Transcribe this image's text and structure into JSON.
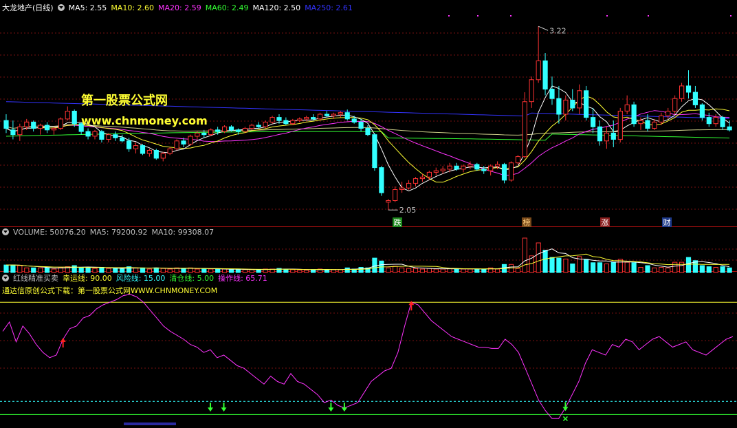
{
  "colors": {
    "ma5": "#ffffff",
    "ma10": "#ffff33",
    "ma20": "#ff33ff",
    "ma60": "#33ff33",
    "ma120": "#ffffff",
    "ma250": "#3333ff",
    "up": "#ff3333",
    "down": "#33ffff",
    "lucky": "#ffff33",
    "risk": "#33ffff",
    "clear": "#33ff33",
    "op": "#ff33ff"
  },
  "price_panel": {
    "stock_name": "大龙地产(日线)",
    "ma_labels": [
      {
        "text": "MA5: 2.55",
        "color": "#ffffff"
      },
      {
        "text": "MA10: 2.60",
        "color": "#ffff33"
      },
      {
        "text": "MA20: 2.59",
        "color": "#ff33ff"
      },
      {
        "text": "MA60: 2.49",
        "color": "#33ff33"
      },
      {
        "text": "MA120: 2.50",
        "color": "#ffffff"
      },
      {
        "text": "MA250: 2.61",
        "color": "#3333ff"
      }
    ],
    "high_label": "3.22",
    "low_label": "2.05",
    "markers": [
      {
        "text": "跌",
        "bg": "#1e8a1e",
        "fg": "#ffffff"
      },
      {
        "text": "榜",
        "bg": "#7a4a1a",
        "fg": "#ffd080"
      },
      {
        "text": "涨",
        "bg": "#8a1e1e",
        "fg": "#ffffff"
      },
      {
        "text": "财",
        "bg": "#1e3a8a",
        "fg": "#ffffff"
      }
    ]
  },
  "watermark": {
    "cn": "第一股票公式网",
    "url": "www.chnmoney.com"
  },
  "volume_panel": {
    "labels": [
      {
        "text": "VOLUME: 50076.20",
        "color": "#c0c0c0"
      },
      {
        "text": "MA5: 79200.92",
        "color": "#c0c0c0"
      },
      {
        "text": "MA10: 99308.07",
        "color": "#c0c0c0"
      }
    ]
  },
  "indicator_panel": {
    "labels": [
      {
        "text": "红线精准买卖",
        "color": "#c0c0c0"
      },
      {
        "text": "幸运线: 90.00",
        "color": "#ffff33"
      },
      {
        "text": "风险线: 15.00",
        "color": "#33ffff"
      },
      {
        "text": "清仓线: 5.00",
        "color": "#33ff33"
      },
      {
        "text": "操作线: 65.71",
        "color": "#ff33ff"
      }
    ],
    "note": "通达信原创公式下载：第一股票公式网WWW.CHNMONEY.COM"
  },
  "chart_data": {
    "type": "candlestick",
    "price_ylim": [
      1.95,
      3.3
    ],
    "indicator_ylim": [
      0,
      100
    ],
    "reference_lines": {
      "lucky": 90,
      "risk": 15,
      "clear": 5
    },
    "ohlc": [
      [
        2.62,
        2.66,
        2.54,
        2.57
      ],
      [
        2.56,
        2.62,
        2.5,
        2.53
      ],
      [
        2.53,
        2.6,
        2.49,
        2.58
      ],
      [
        2.58,
        2.63,
        2.56,
        2.61
      ],
      [
        2.61,
        2.62,
        2.55,
        2.57
      ],
      [
        2.57,
        2.6,
        2.53,
        2.59
      ],
      [
        2.59,
        2.61,
        2.54,
        2.56
      ],
      [
        2.56,
        2.58,
        2.53,
        2.57
      ],
      [
        2.57,
        2.64,
        2.56,
        2.63
      ],
      [
        2.63,
        2.71,
        2.62,
        2.68
      ],
      [
        2.68,
        2.69,
        2.58,
        2.6
      ],
      [
        2.6,
        2.61,
        2.53,
        2.55
      ],
      [
        2.55,
        2.57,
        2.5,
        2.52
      ],
      [
        2.52,
        2.56,
        2.5,
        2.55
      ],
      [
        2.55,
        2.56,
        2.48,
        2.5
      ],
      [
        2.5,
        2.54,
        2.48,
        2.53
      ],
      [
        2.53,
        2.55,
        2.49,
        2.51
      ],
      [
        2.51,
        2.53,
        2.48,
        2.49
      ],
      [
        2.49,
        2.51,
        2.42,
        2.44
      ],
      [
        2.44,
        2.48,
        2.41,
        2.46
      ],
      [
        2.46,
        2.47,
        2.4,
        2.41
      ],
      [
        2.41,
        2.44,
        2.39,
        2.43
      ],
      [
        2.43,
        2.44,
        2.37,
        2.38
      ],
      [
        2.38,
        2.42,
        2.36,
        2.41
      ],
      [
        2.41,
        2.45,
        2.4,
        2.44
      ],
      [
        2.44,
        2.5,
        2.43,
        2.49
      ],
      [
        2.49,
        2.51,
        2.45,
        2.47
      ],
      [
        2.47,
        2.53,
        2.46,
        2.52
      ],
      [
        2.52,
        2.55,
        2.5,
        2.54
      ],
      [
        2.54,
        2.56,
        2.51,
        2.53
      ],
      [
        2.53,
        2.57,
        2.52,
        2.56
      ],
      [
        2.56,
        2.58,
        2.53,
        2.55
      ],
      [
        2.55,
        2.59,
        2.54,
        2.58
      ],
      [
        2.58,
        2.59,
        2.55,
        2.56
      ],
      [
        2.56,
        2.57,
        2.53,
        2.55
      ],
      [
        2.55,
        2.58,
        2.54,
        2.57
      ],
      [
        2.57,
        2.6,
        2.56,
        2.59
      ],
      [
        2.59,
        2.61,
        2.57,
        2.58
      ],
      [
        2.58,
        2.62,
        2.57,
        2.61
      ],
      [
        2.61,
        2.65,
        2.6,
        2.64
      ],
      [
        2.64,
        2.66,
        2.6,
        2.62
      ],
      [
        2.62,
        2.64,
        2.59,
        2.6
      ],
      [
        2.6,
        2.63,
        2.59,
        2.62
      ],
      [
        2.62,
        2.64,
        2.61,
        2.63
      ],
      [
        2.63,
        2.65,
        2.62,
        2.64
      ],
      [
        2.64,
        2.66,
        2.62,
        2.63
      ],
      [
        2.63,
        2.67,
        2.62,
        2.66
      ],
      [
        2.66,
        2.68,
        2.64,
        2.65
      ],
      [
        2.65,
        2.67,
        2.63,
        2.66
      ],
      [
        2.66,
        2.68,
        2.64,
        2.67
      ],
      [
        2.67,
        2.69,
        2.62,
        2.63
      ],
      [
        2.63,
        2.65,
        2.6,
        2.61
      ],
      [
        2.61,
        2.63,
        2.55,
        2.57
      ],
      [
        2.57,
        2.59,
        2.52,
        2.53
      ],
      [
        2.53,
        2.54,
        2.3,
        2.32
      ],
      [
        2.32,
        2.33,
        2.14,
        2.16
      ],
      [
        2.1,
        2.12,
        2.05,
        2.11
      ],
      [
        2.11,
        2.2,
        2.1,
        2.18
      ],
      [
        2.18,
        2.23,
        2.16,
        2.19
      ],
      [
        2.19,
        2.24,
        2.18,
        2.22
      ],
      [
        2.22,
        2.26,
        2.2,
        2.25
      ],
      [
        2.25,
        2.28,
        2.23,
        2.26
      ],
      [
        2.26,
        2.3,
        2.24,
        2.29
      ],
      [
        2.29,
        2.32,
        2.27,
        2.3
      ],
      [
        2.3,
        2.33,
        2.28,
        2.31
      ],
      [
        2.31,
        2.35,
        2.29,
        2.33
      ],
      [
        2.33,
        2.35,
        2.3,
        2.31
      ],
      [
        2.31,
        2.34,
        2.29,
        2.33
      ],
      [
        2.33,
        2.36,
        2.31,
        2.34
      ],
      [
        2.34,
        2.35,
        2.3,
        2.31
      ],
      [
        2.31,
        2.33,
        2.28,
        2.3
      ],
      [
        2.3,
        2.34,
        2.27,
        2.33
      ],
      [
        2.33,
        2.36,
        2.31,
        2.34
      ],
      [
        2.34,
        2.35,
        2.22,
        2.24
      ],
      [
        2.24,
        2.36,
        2.23,
        2.35
      ],
      [
        2.35,
        2.4,
        2.34,
        2.39
      ],
      [
        2.39,
        2.8,
        2.38,
        2.74
      ],
      [
        2.74,
        2.9,
        2.7,
        2.88
      ],
      [
        2.88,
        3.22,
        2.86,
        3.0
      ],
      [
        3.0,
        3.05,
        2.78,
        2.82
      ],
      [
        2.82,
        2.9,
        2.72,
        2.76
      ],
      [
        2.76,
        2.84,
        2.6,
        2.66
      ],
      [
        2.66,
        2.78,
        2.62,
        2.75
      ],
      [
        2.75,
        2.82,
        2.68,
        2.7
      ],
      [
        2.7,
        2.85,
        2.66,
        2.81
      ],
      [
        2.81,
        2.84,
        2.62,
        2.64
      ],
      [
        2.64,
        2.7,
        2.54,
        2.58
      ],
      [
        2.58,
        2.62,
        2.46,
        2.49
      ],
      [
        2.49,
        2.58,
        2.44,
        2.54
      ],
      [
        2.54,
        2.62,
        2.45,
        2.5
      ],
      [
        2.5,
        2.7,
        2.48,
        2.68
      ],
      [
        2.68,
        2.78,
        2.66,
        2.72
      ],
      [
        2.72,
        2.74,
        2.58,
        2.6
      ],
      [
        2.6,
        2.64,
        2.56,
        2.62
      ],
      [
        2.62,
        2.66,
        2.55,
        2.57
      ],
      [
        2.57,
        2.63,
        2.56,
        2.61
      ],
      [
        2.61,
        2.67,
        2.59,
        2.65
      ],
      [
        2.65,
        2.7,
        2.63,
        2.68
      ],
      [
        2.68,
        2.78,
        2.66,
        2.76
      ],
      [
        2.76,
        2.86,
        2.74,
        2.84
      ],
      [
        2.84,
        2.94,
        2.76,
        2.8
      ],
      [
        2.8,
        2.84,
        2.7,
        2.72
      ],
      [
        2.72,
        2.73,
        2.62,
        2.64
      ],
      [
        2.64,
        2.67,
        2.58,
        2.6
      ],
      [
        2.6,
        2.66,
        2.58,
        2.64
      ],
      [
        2.64,
        2.65,
        2.56,
        2.58
      ],
      [
        2.58,
        2.62,
        2.55,
        2.56
      ]
    ],
    "indicator_values": [
      68,
      75,
      60,
      72,
      66,
      58,
      52,
      48,
      50,
      62,
      70,
      72,
      78,
      80,
      85,
      88,
      90,
      92,
      95,
      96,
      94,
      90,
      84,
      78,
      72,
      68,
      65,
      62,
      58,
      56,
      52,
      54,
      48,
      50,
      46,
      42,
      40,
      36,
      32,
      28,
      34,
      30,
      28,
      36,
      30,
      28,
      24,
      20,
      14,
      16,
      12,
      10,
      12,
      14,
      22,
      30,
      34,
      38,
      40,
      52,
      72,
      90,
      88,
      82,
      76,
      72,
      68,
      64,
      62,
      60,
      58,
      56,
      56,
      55,
      55,
      62,
      58,
      52,
      40,
      28,
      16,
      8,
      2,
      2,
      10,
      20,
      30,
      44,
      54,
      52,
      50,
      58,
      56,
      62,
      60,
      54,
      58,
      62,
      64,
      60,
      56,
      58,
      60,
      54,
      52,
      50,
      54,
      58,
      62,
      64
    ],
    "buy_indices": [
      9,
      61
    ],
    "sell_indices": [
      31,
      33,
      49,
      51
    ],
    "exit_index": 84
  }
}
